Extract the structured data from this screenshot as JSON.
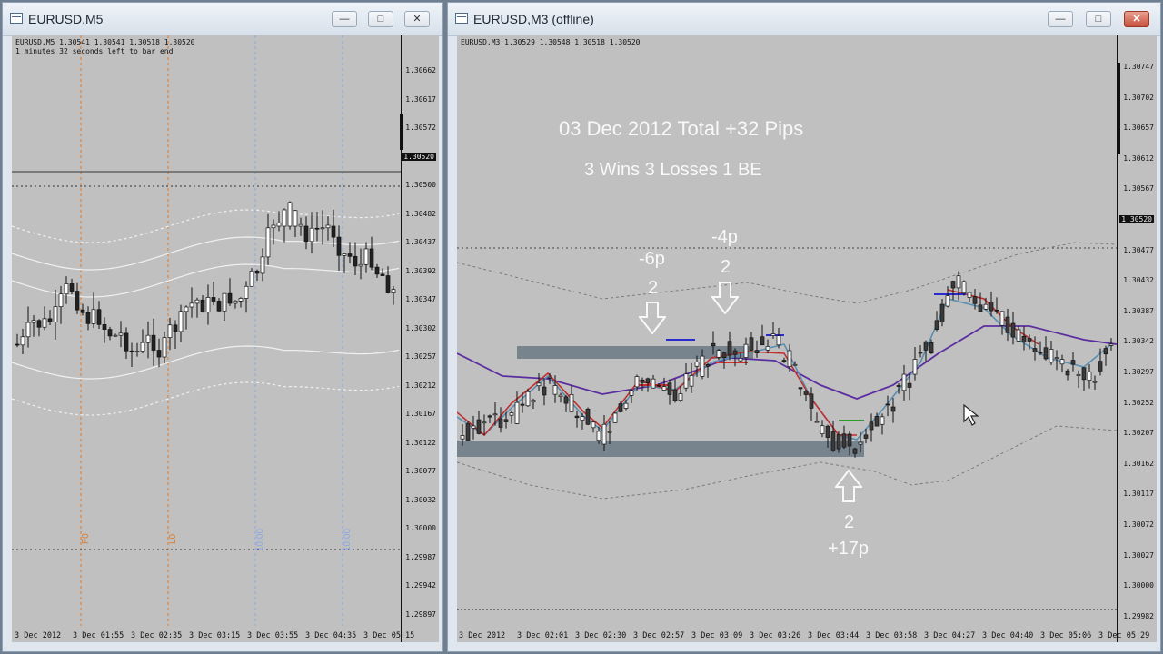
{
  "left_window": {
    "title": "EURUSD,M5",
    "info_line1": "EURUSD,M5  1.30541 1.30541 1.30518 1.30520",
    "info_line2": "1 minutes 32 seconds left to bar end",
    "prices": [
      "1.30662",
      "1.30617",
      "1.30572",
      "1.30520",
      "1.30500",
      "1.30482",
      "1.30437",
      "1.30392",
      "1.30347",
      "1.30302",
      "1.30257",
      "1.30212",
      "1.30167",
      "1.30122",
      "1.30077",
      "1.30032",
      "1.30000",
      "1.29987",
      "1.29942",
      "1.29897"
    ],
    "current_price": "1.30520",
    "time_labels": [
      "3 Dec 2012",
      "3 Dec 01:55",
      "3 Dec 02:35",
      "3 Dec 03:15",
      "3 Dec 03:55",
      "3 Dec 04:35",
      "3 Dec 05:15"
    ],
    "vline_labels": [
      "F0",
      "L0",
      "10:00",
      "10:00"
    ],
    "colors": {
      "orange_line": "#e07a2a",
      "blue_line": "#8aa8e0",
      "band": "#f0f0f0"
    }
  },
  "right_window": {
    "title": "EURUSD,M3 (offline)",
    "info_line1": "EURUSD,M3  1.30529 1.30548 1.30518 1.30520",
    "prices": [
      "1.30747",
      "1.30702",
      "1.30657",
      "1.30612",
      "1.30567",
      "1.30520",
      "1.30477",
      "1.30432",
      "1.30387",
      "1.30342",
      "1.30297",
      "1.30252",
      "1.30207",
      "1.30162",
      "1.30117",
      "1.30072",
      "1.30027",
      "1.30000",
      "1.29982"
    ],
    "current_price": "1.30520",
    "level_price": "1.30000",
    "time_labels": [
      "3 Dec 2012",
      "3 Dec 02:01",
      "3 Dec 02:30",
      "3 Dec 02:57",
      "3 Dec 03:09",
      "3 Dec 03:26",
      "3 Dec 03:44",
      "3 Dec 03:58",
      "3 Dec 04:27",
      "3 Dec 04:40",
      "3 Dec 05:06",
      "3 Dec 05:29"
    ],
    "headline": "03 Dec 2012  Total +32 Pips",
    "summary": "3 Wins  3 Losses  1 BE",
    "trade1": {
      "result": "-6p",
      "count": "2"
    },
    "trade2": {
      "result": "-4p",
      "count": "2"
    },
    "trade3": {
      "count": "2",
      "result": "+17p"
    },
    "colors": {
      "purple_ma": "#5b2ea0",
      "red_ma": "#c03030",
      "teal_ma": "#5a8fb0",
      "zone": "#6f7d88"
    }
  }
}
